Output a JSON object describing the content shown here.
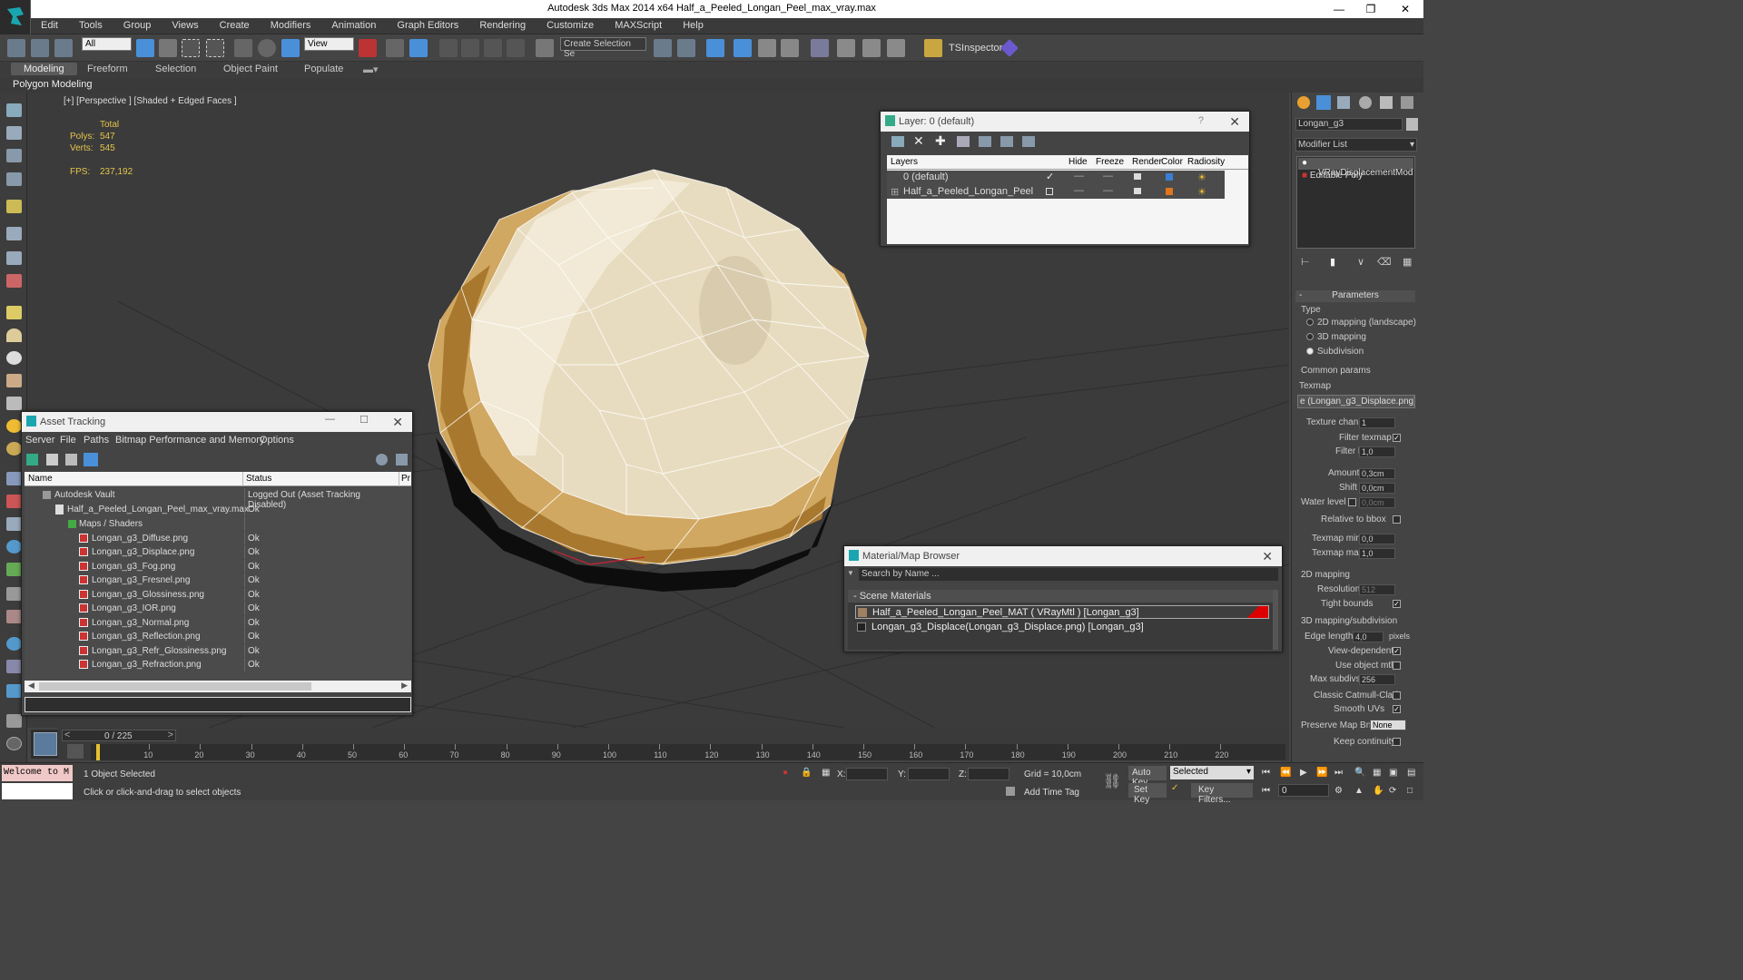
{
  "window": {
    "title": "Autodesk 3ds Max  2014 x64     Half_a_Peeled_Longan_Peel_max_vray.max"
  },
  "menu": [
    "Edit",
    "Tools",
    "Group",
    "Views",
    "Create",
    "Modifiers",
    "Animation",
    "Graph Editors",
    "Rendering",
    "Customize",
    "MAXScript",
    "Help"
  ],
  "toolbar": {
    "selection_filter": "All",
    "ref_coord": "View",
    "named_selection": "Create Selection Se",
    "plugin_label": "TSInspector"
  },
  "ribbon": {
    "tabs": [
      "Modeling",
      "Freeform",
      "Selection",
      "Object Paint",
      "Populate"
    ],
    "active": "Modeling",
    "sub": "Polygon Modeling"
  },
  "viewport": {
    "label": "[+] [Perspective ] [Shaded + Edged Faces ]",
    "stats": {
      "total_label": "Total",
      "polys_label": "Polys:",
      "polys": "547",
      "verts_label": "Verts:",
      "verts": "545",
      "fps_label": "FPS:",
      "fps": "237,192"
    }
  },
  "layer_dialog": {
    "title": "Layer: 0 (default)",
    "help": "?",
    "columns": [
      "Layers",
      "Hide",
      "Freeze",
      "Render",
      "Color",
      "Radiosity"
    ],
    "rows": [
      {
        "name": "0 (default)",
        "color": "#3a7fd5"
      },
      {
        "name": "Half_a_Peeled_Longan_Peel",
        "color": "#e0751e"
      }
    ]
  },
  "asset_dialog": {
    "title": "Asset Tracking",
    "menu": [
      "Server",
      "File",
      "Paths",
      "Bitmap Performance and Memory",
      "Options"
    ],
    "columns": [
      "Name",
      "Status",
      "Pr"
    ],
    "vault": {
      "name": "Autodesk Vault",
      "status": "Logged Out (Asset Tracking Disabled)"
    },
    "file": {
      "name": "Half_a_Peeled_Longan_Peel_max_vray.max",
      "status": "Ok"
    },
    "folder": {
      "name": "Maps / Shaders"
    },
    "maps": [
      {
        "name": "Longan_g3_Diffuse.png",
        "status": "Ok"
      },
      {
        "name": "Longan_g3_Displace.png",
        "status": "Ok"
      },
      {
        "name": "Longan_g3_Fog.png",
        "status": "Ok"
      },
      {
        "name": "Longan_g3_Fresnel.png",
        "status": "Ok"
      },
      {
        "name": "Longan_g3_Glossiness.png",
        "status": "Ok"
      },
      {
        "name": "Longan_g3_IOR.png",
        "status": "Ok"
      },
      {
        "name": "Longan_g3_Normal.png",
        "status": "Ok"
      },
      {
        "name": "Longan_g3_Reflection.png",
        "status": "Ok"
      },
      {
        "name": "Longan_g3_Refr_Glossiness.png",
        "status": "Ok"
      },
      {
        "name": "Longan_g3_Refraction.png",
        "status": "Ok"
      }
    ]
  },
  "material_dialog": {
    "title": "Material/Map Browser",
    "search_placeholder": "Search by Name ...",
    "section": "- Scene Materials",
    "items": [
      "Half_a_Peeled_Longan_Peel_MAT  ( VRayMtl )  [Longan_g3]",
      "Longan_g3_Displace(Longan_g3_Displace.png) [Longan_g3]"
    ]
  },
  "command_panel": {
    "object_name": "Longan_g3",
    "modifier_list": "Modifier List",
    "stack": [
      "VRayDisplacementMod",
      "Editable Poly"
    ],
    "rollout": "Parameters",
    "type_label": "Type",
    "type_options": [
      "2D mapping (landscape)",
      "3D mapping",
      "Subdivision"
    ],
    "common_label": "Common params",
    "texmap_label": "Texmap",
    "texmap_value": "e (Longan_g3_Displace.png)",
    "texture_chan_label": "Texture chan",
    "texture_chan": "1",
    "filter_texmap_label": "Filter texmap",
    "filter_blur_label": "Filter blur",
    "filter_blur": "1,0",
    "amount_label": "Amount",
    "amount": "0,3cm",
    "shift_label": "Shift",
    "shift": "0,0cm",
    "water_label": "Water level",
    "water": "0,0cm",
    "relative_label": "Relative to bbox",
    "texmap_min_label": "Texmap min",
    "texmap_min": "0,0",
    "texmap_max_label": "Texmap max",
    "texmap_max": "1,0",
    "map2d_label": "2D mapping",
    "resolution_label": "Resolution",
    "resolution": "512",
    "tight_label": "Tight bounds",
    "map3d_label": "3D mapping/subdivision",
    "edge_label": "Edge length",
    "edge": "4,0",
    "pixels": "pixels",
    "view_dep_label": "View-dependent",
    "use_obj_label": "Use object mtl",
    "max_subdivs_label": "Max subdivs",
    "max_subdivs": "256",
    "catmull_label": "Classic Catmull-Clark",
    "smooth_label": "Smooth UVs",
    "preserve_label": "Preserve Map Bnd",
    "preserve": "None",
    "keep_label": "Keep continuity"
  },
  "timeline": {
    "frame": "0 / 225",
    "ticks": [
      "10",
      "20",
      "30",
      "40",
      "50",
      "60",
      "70",
      "80",
      "90",
      "100",
      "110",
      "120",
      "130",
      "140",
      "150",
      "160",
      "170",
      "180",
      "190",
      "200",
      "210",
      "220"
    ]
  },
  "status": {
    "script": "Welcome to M",
    "selected": "1 Object Selected",
    "prompt": "Click or click-and-drag to select objects",
    "x_label": "X:",
    "y_label": "Y:",
    "z_label": "Z:",
    "grid": "Grid = 10,0cm",
    "add_time_tag": "Add Time Tag",
    "auto_key": "Auto Key",
    "set_key": "Set Key",
    "key_mode": "Selected",
    "key_filters": "Key Filters...",
    "frame_value": "0"
  }
}
